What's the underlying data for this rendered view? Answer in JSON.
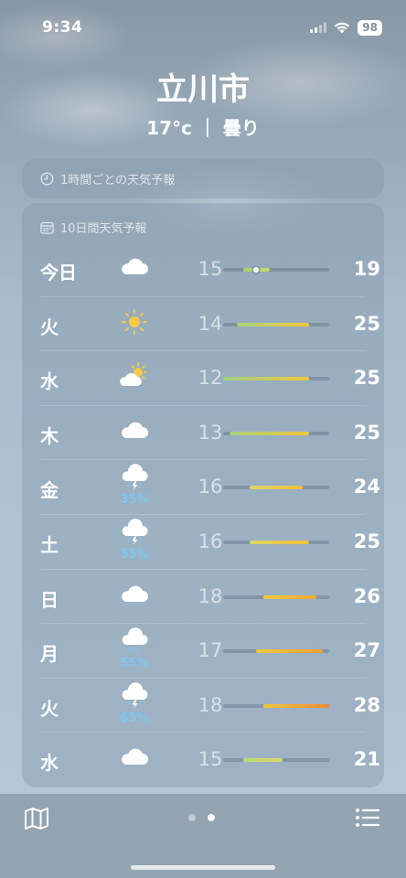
{
  "status_bar": {
    "time": "9:34",
    "battery": "98"
  },
  "location": {
    "city": "立川市",
    "summary": "17°c ｜ 曇り"
  },
  "hourly_card": {
    "label": "1時間ごとの天気予報"
  },
  "daily_card": {
    "label": "10日間天気予報",
    "range_min": 12,
    "range_max": 28,
    "current_temp": 17,
    "days": [
      {
        "day": "今日",
        "icon": "cloud-icon",
        "precip": "",
        "low": "15",
        "high": "19",
        "lo": 15,
        "hi": 19,
        "colors": [
          "#a7d36a",
          "#c9d86a"
        ],
        "current": true
      },
      {
        "day": "火",
        "icon": "sun-icon",
        "precip": "",
        "low": "14",
        "high": "25",
        "lo": 14,
        "hi": 25,
        "colors": [
          "#a9d477",
          "#f2c53d"
        ]
      },
      {
        "day": "水",
        "icon": "partly-cloudy-icon",
        "precip": "",
        "low": "12",
        "high": "25",
        "lo": 12,
        "hi": 25,
        "colors": [
          "#9ed08a",
          "#f2c53d"
        ]
      },
      {
        "day": "木",
        "icon": "cloud-icon",
        "precip": "",
        "low": "13",
        "high": "25",
        "lo": 13,
        "hi": 25,
        "colors": [
          "#a5d27d",
          "#f2c53d"
        ]
      },
      {
        "day": "金",
        "icon": "thunderstorm-icon",
        "precip": "35%",
        "low": "16",
        "high": "24",
        "lo": 16,
        "hi": 24,
        "colors": [
          "#d8d86a",
          "#f3bd3a"
        ]
      },
      {
        "day": "土",
        "icon": "thunderstorm-icon",
        "precip": "55%",
        "low": "16",
        "high": "25",
        "lo": 16,
        "hi": 25,
        "colors": [
          "#d8d86a",
          "#f3bd3a"
        ]
      },
      {
        "day": "日",
        "icon": "cloud-icon",
        "precip": "",
        "low": "18",
        "high": "26",
        "lo": 18,
        "hi": 26,
        "colors": [
          "#f0c93d",
          "#f1a937"
        ]
      },
      {
        "day": "月",
        "icon": "rain-icon",
        "precip": "55%",
        "low": "17",
        "high": "27",
        "lo": 17,
        "hi": 27,
        "colors": [
          "#eecb3f",
          "#f09d37"
        ]
      },
      {
        "day": "火",
        "icon": "thunderstorm-icon",
        "precip": "65%",
        "low": "18",
        "high": "28",
        "lo": 18,
        "hi": 28,
        "colors": [
          "#f0c93d",
          "#ee8a32"
        ]
      },
      {
        "day": "水",
        "icon": "cloud-icon",
        "precip": "",
        "low": "15",
        "high": "21",
        "lo": 15,
        "hi": 21,
        "colors": [
          "#b8d873",
          "#dcd864"
        ]
      }
    ]
  },
  "bottom_bar": {
    "map_icon": "map-icon",
    "list_icon": "list-icon",
    "pages": 2,
    "active_page": 1
  }
}
